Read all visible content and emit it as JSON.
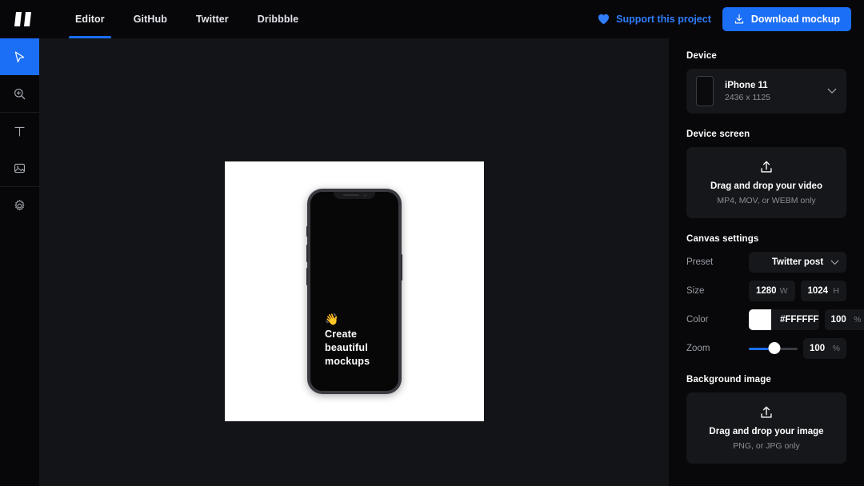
{
  "header": {
    "logo_name": "app-logo",
    "nav": [
      {
        "label": "Editor",
        "active": true
      },
      {
        "label": "GitHub",
        "active": false
      },
      {
        "label": "Twitter",
        "active": false
      },
      {
        "label": "Dribbble",
        "active": false
      }
    ],
    "support_label": "Support this project",
    "download_label": "Download mockup",
    "accent_color": "#1b6ef6",
    "heart_color": "#2f7dfa"
  },
  "toolbar": {
    "tools": [
      {
        "name": "select-tool",
        "icon": "cursor-icon",
        "active": true
      },
      {
        "name": "zoom-tool",
        "icon": "zoom-in-icon",
        "active": false
      },
      {
        "name": "text-tool",
        "icon": "text-icon",
        "active": false
      },
      {
        "name": "image-tool",
        "icon": "image-icon",
        "active": false
      },
      {
        "name": "settings-tool",
        "icon": "gear-icon",
        "active": false
      }
    ]
  },
  "canvas": {
    "background_color": "#FFFFFF",
    "phone": {
      "emoji": "👋",
      "line1": "Create",
      "line2": "beautiful",
      "line3": "mockups"
    }
  },
  "panel": {
    "device_section": {
      "title": "Device",
      "device_name": "iPhone 11",
      "resolution": "2436 x 1125"
    },
    "device_screen_section": {
      "title": "Device screen",
      "drop_title": "Drag and drop your video",
      "drop_sub": "MP4, MOV, or WEBM only"
    },
    "canvas_settings": {
      "title": "Canvas settings",
      "preset_label": "Preset",
      "preset_value": "Twitter post",
      "size_label": "Size",
      "width_value": "1280",
      "width_unit": "W",
      "height_value": "1024",
      "height_unit": "H",
      "color_label": "Color",
      "color_hex": "#FFFFFF",
      "color_opacity": "100",
      "opacity_unit": "%",
      "zoom_label": "Zoom",
      "zoom_value": "100",
      "zoom_unit": "%",
      "zoom_percent": 52
    },
    "background_image_section": {
      "title": "Background image",
      "drop_title": "Drag and drop your image",
      "drop_sub": "PNG, or JPG only"
    }
  }
}
